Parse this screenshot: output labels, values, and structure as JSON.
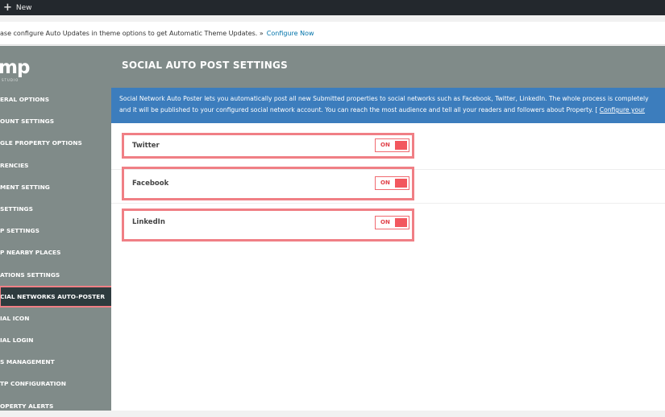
{
  "adminbar": {
    "new_label": "New"
  },
  "notice": {
    "text": "ase configure Auto Updates in theme options to get Automatic Theme Updates. »",
    "link": "Configure Now"
  },
  "logo": {
    "text": "mp",
    "sub": "STUDIO"
  },
  "sidebar": {
    "items": [
      {
        "label": "ERAL OPTIONS"
      },
      {
        "label": "OUNT SETTINGS"
      },
      {
        "label": "GLE PROPERTY OPTIONS"
      },
      {
        "label": "RENCIES"
      },
      {
        "label": "MENT SETTING"
      },
      {
        "label": "SETTINGS"
      },
      {
        "label": "P SETTINGS"
      },
      {
        "label": "P NEARBY PLACES"
      },
      {
        "label": "ATIONS SETTINGS"
      },
      {
        "label": "CIAL NETWORKS AUTO-POSTER"
      },
      {
        "label": "IAL ICON"
      },
      {
        "label": "IAL LOGIN"
      },
      {
        "label": "S MANAGEMENT"
      },
      {
        "label": "TP CONFIGURATION"
      },
      {
        "label": "OPERTY ALERTS"
      }
    ]
  },
  "page": {
    "title": "SOCIAL AUTO POST SETTINGS",
    "info_line1": "Social Network Auto Poster lets you automatically post all new Submitted properties to social networks such as Facebook, Twitter, LinkedIn. The whole process is completely",
    "info_line2": "and it will be published to your configured social network account. You can reach the most audience and tell all your readers and followers about Property. [",
    "info_link": "Configure your"
  },
  "networks": [
    {
      "label": "Twitter",
      "state": "ON"
    },
    {
      "label": "Facebook",
      "state": "ON"
    },
    {
      "label": "LinkedIn",
      "state": "ON"
    }
  ],
  "colors": {
    "sidebar_bg": "#808b89",
    "active_item_bg": "#2e3b3e",
    "highlight": "#f07f85",
    "info_bg": "#3c7dbd",
    "toggle_on": "#f2575e"
  }
}
